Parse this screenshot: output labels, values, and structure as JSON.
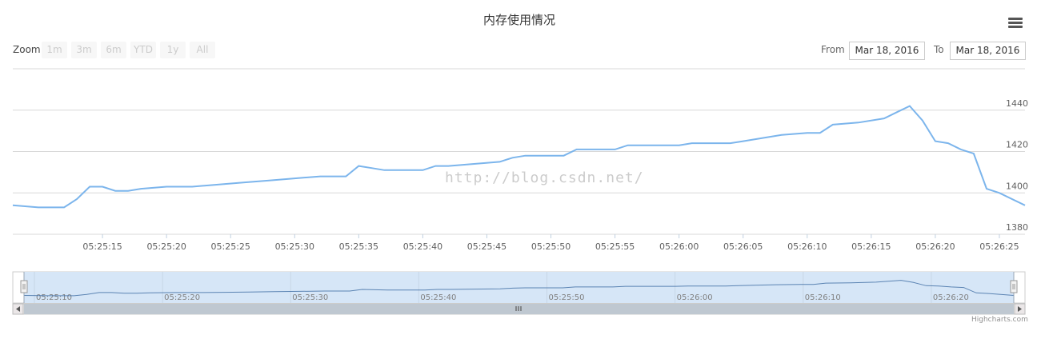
{
  "title": "内存使用情况",
  "menu_icon": "hamburger-menu-icon",
  "zoom": {
    "label": "Zoom",
    "buttons": [
      "1m",
      "3m",
      "6m",
      "YTD",
      "1y",
      "All"
    ]
  },
  "range": {
    "from_label": "From",
    "from_value": "Mar 18, 2016",
    "to_label": "To",
    "to_value": "Mar 18, 2016"
  },
  "watermark": "http://blog.csdn.net/",
  "credits": "Highcharts.com",
  "colors": {
    "series": "#7cb5ec",
    "navigator_fill": "#d6e6f7",
    "scrollbar": "#bfc8d1"
  },
  "scrollbar_thumb_icon": "grip-icon",
  "navigator_handle_icon": "drag-handle-icon",
  "scroll_arrow_left_icon": "arrow-left-icon",
  "scroll_arrow_right_icon": "arrow-right-icon",
  "chart_data": {
    "type": "line",
    "title": "内存使用情况",
    "x_type": "time",
    "x_range": [
      "05:25:08",
      "05:26:27"
    ],
    "y_range": [
      1380,
      1460
    ],
    "y_ticks": [
      1380,
      1400,
      1420,
      1440
    ],
    "y_axis_side": "right",
    "grid": true,
    "x_ticks": [
      "05:25:15",
      "05:25:20",
      "05:25:25",
      "05:25:30",
      "05:25:35",
      "05:25:40",
      "05:25:45",
      "05:25:50",
      "05:25:55",
      "05:26:00",
      "05:26:05",
      "05:26:10",
      "05:26:15",
      "05:26:20",
      "05:26:25"
    ],
    "navigator_ticks": [
      "05:25:10",
      "05:25:20",
      "05:25:30",
      "05:25:40",
      "05:25:50",
      "05:26:00",
      "05:26:10",
      "05:26:20"
    ],
    "series": [
      {
        "x": [
          "05:25:08",
          "05:25:10",
          "05:25:11",
          "05:25:12",
          "05:25:13",
          "05:25:14",
          "05:25:15",
          "05:25:16",
          "05:25:17",
          "05:25:18",
          "05:25:20",
          "05:25:22",
          "05:25:24",
          "05:25:26",
          "05:25:28",
          "05:25:30",
          "05:25:32",
          "05:25:33",
          "05:25:34",
          "05:25:35",
          "05:25:36",
          "05:25:37",
          "05:25:38",
          "05:25:40",
          "05:25:41",
          "05:25:42",
          "05:25:44",
          "05:25:46",
          "05:25:47",
          "05:25:48",
          "05:25:50",
          "05:25:51",
          "05:25:52",
          "05:25:54",
          "05:25:55",
          "05:25:56",
          "05:25:58",
          "05:26:00",
          "05:26:01",
          "05:26:02",
          "05:26:04",
          "05:26:05",
          "05:26:06",
          "05:26:08",
          "05:26:10",
          "05:26:11",
          "05:26:12",
          "05:26:14",
          "05:26:16",
          "05:26:17",
          "05:26:18",
          "05:26:19",
          "05:26:20",
          "05:26:21",
          "05:26:22",
          "05:26:23",
          "05:26:24",
          "05:26:25",
          "05:26:27"
        ],
        "y": [
          1394,
          1393,
          1393,
          1393,
          1397,
          1403,
          1403,
          1401,
          1401,
          1402,
          1403,
          1403,
          1404,
          1405,
          1406,
          1407,
          1408,
          1408,
          1408,
          1413,
          1412,
          1411,
          1411,
          1411,
          1413,
          1413,
          1414,
          1415,
          1417,
          1418,
          1418,
          1418,
          1421,
          1421,
          1421,
          1423,
          1423,
          1423,
          1424,
          1424,
          1424,
          1425,
          1426,
          1428,
          1429,
          1429,
          1433,
          1434,
          1436,
          1439,
          1442,
          1435,
          1425,
          1424,
          1421,
          1419,
          1402,
          1400,
          1394
        ]
      }
    ]
  }
}
